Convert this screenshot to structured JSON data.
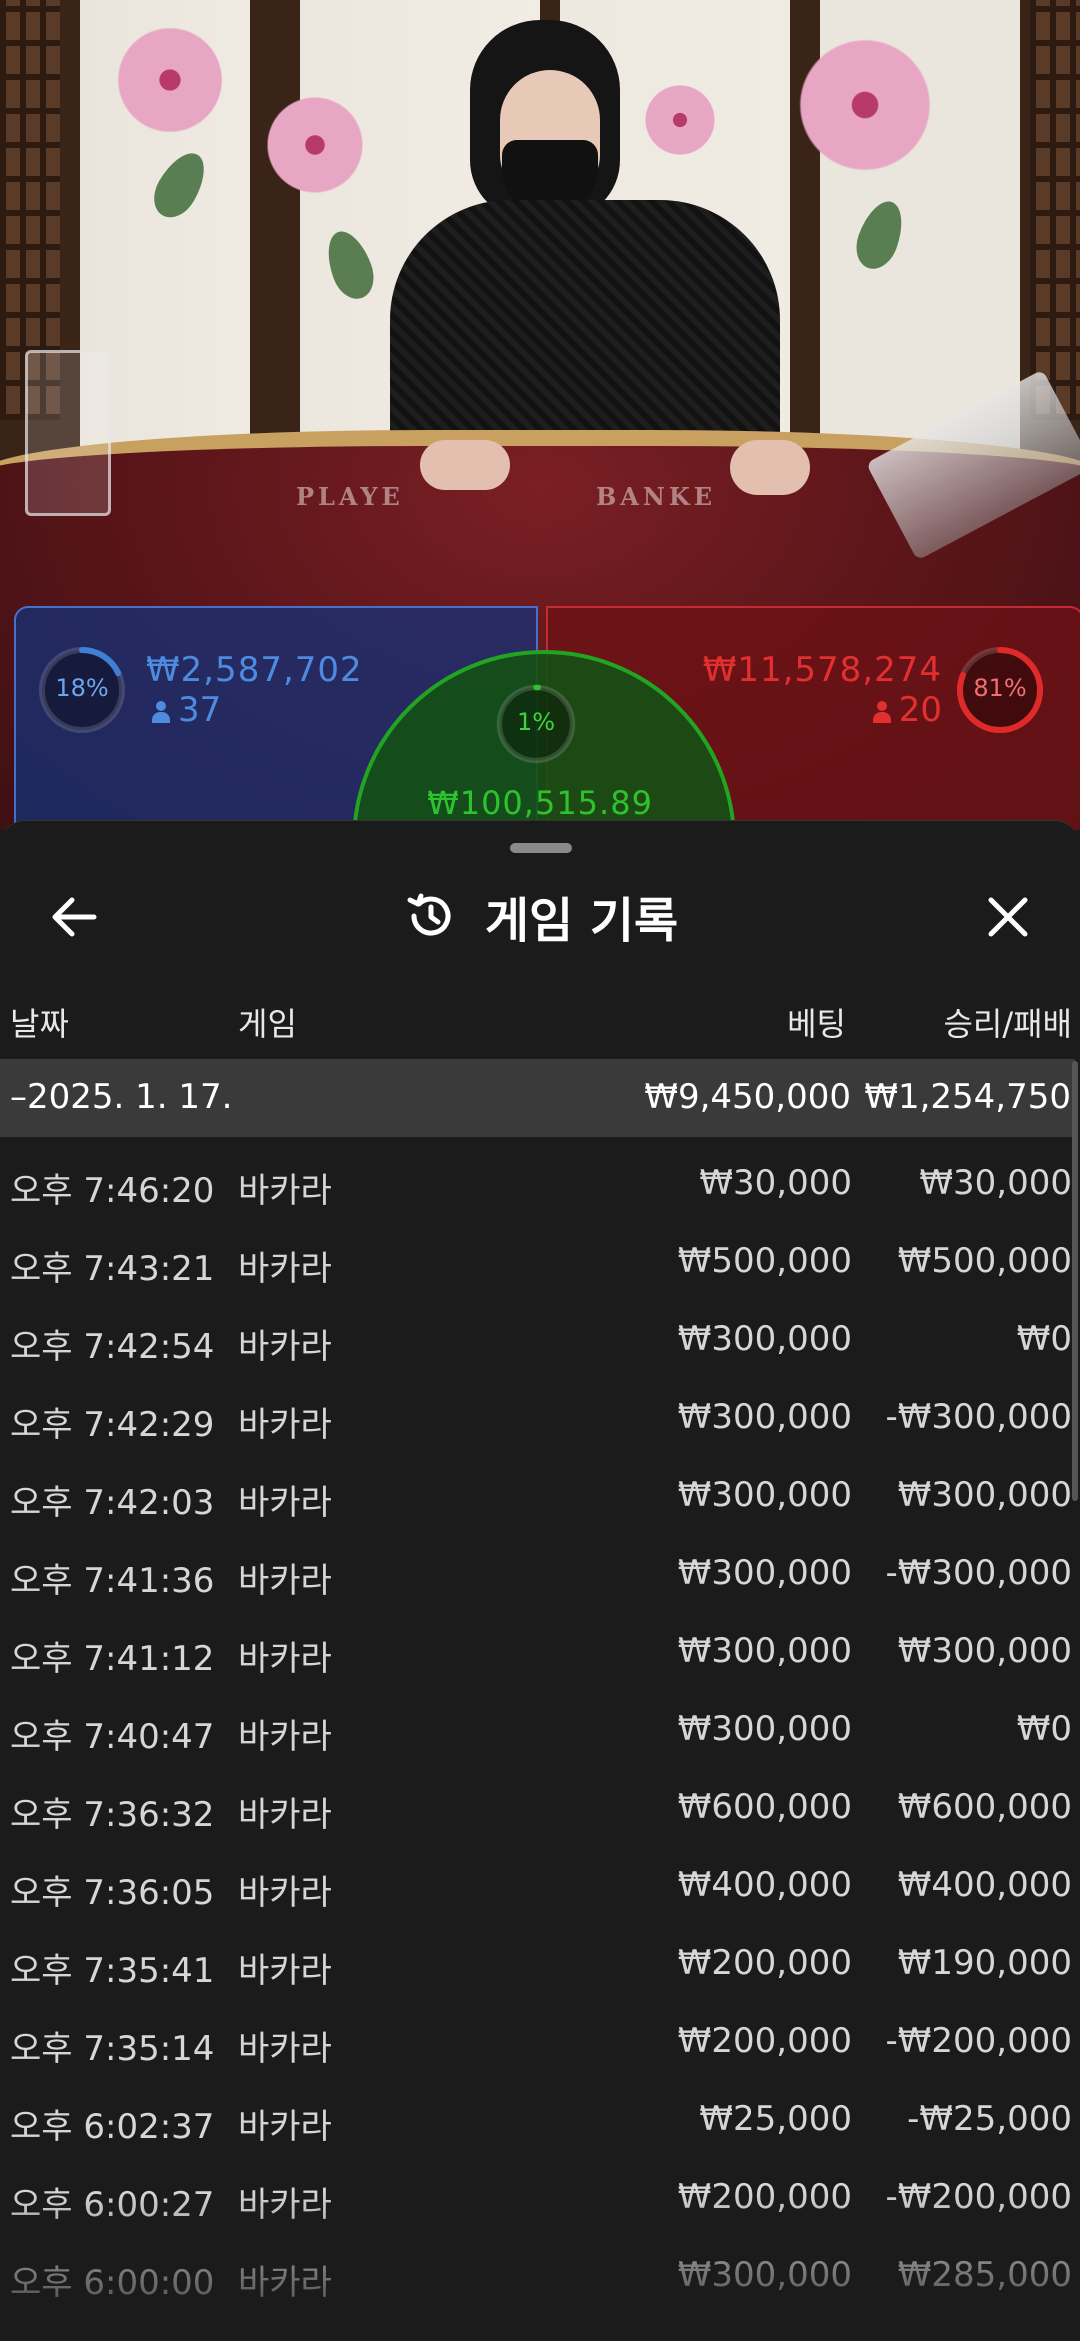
{
  "live_table": {
    "table_text_player": "PLAYE",
    "table_text_banker": "BANKE",
    "player": {
      "percent": "18%",
      "percent_value": 0.18,
      "amount": "₩2,587,702",
      "players": "37",
      "color": "#3f7fd6"
    },
    "banker": {
      "percent": "81%",
      "percent_value": 0.81,
      "amount": "₩11,578,274",
      "players": "20",
      "color": "#e02a2a"
    },
    "tie": {
      "percent": "1%",
      "percent_value": 0.01,
      "amount": "₩100,515.89",
      "color": "#2ec22e"
    }
  },
  "sheet": {
    "title": "게임 기록",
    "back_icon": "arrow-left-icon",
    "history_icon": "history-icon",
    "close_icon": "close-icon",
    "columns": {
      "date": "날짜",
      "game": "게임",
      "bet": "베팅",
      "result": "승리/패배"
    },
    "date_group": {
      "date": "–2025. 1. 17.",
      "bet_total": "₩9,450,000",
      "result_total": "₩1,254,750"
    },
    "rows": [
      {
        "time": "오후 7:46:20",
        "game": "바카라",
        "bet": "₩30,000",
        "result": "₩30,000"
      },
      {
        "time": "오후 7:43:21",
        "game": "바카라",
        "bet": "₩500,000",
        "result": "₩500,000"
      },
      {
        "time": "오후 7:42:54",
        "game": "바카라",
        "bet": "₩300,000",
        "result": "₩0"
      },
      {
        "time": "오후 7:42:29",
        "game": "바카라",
        "bet": "₩300,000",
        "result": "-₩300,000"
      },
      {
        "time": "오후 7:42:03",
        "game": "바카라",
        "bet": "₩300,000",
        "result": "₩300,000"
      },
      {
        "time": "오후 7:41:36",
        "game": "바카라",
        "bet": "₩300,000",
        "result": "-₩300,000"
      },
      {
        "time": "오후 7:41:12",
        "game": "바카라",
        "bet": "₩300,000",
        "result": "₩300,000"
      },
      {
        "time": "오후 7:40:47",
        "game": "바카라",
        "bet": "₩300,000",
        "result": "₩0"
      },
      {
        "time": "오후 7:36:32",
        "game": "바카라",
        "bet": "₩600,000",
        "result": "₩600,000"
      },
      {
        "time": "오후 7:36:05",
        "game": "바카라",
        "bet": "₩400,000",
        "result": "₩400,000"
      },
      {
        "time": "오후 7:35:41",
        "game": "바카라",
        "bet": "₩200,000",
        "result": "₩190,000"
      },
      {
        "time": "오후 7:35:14",
        "game": "바카라",
        "bet": "₩200,000",
        "result": "-₩200,000"
      },
      {
        "time": "오후 6:02:37",
        "game": "바카라",
        "bet": "₩25,000",
        "result": "-₩25,000"
      },
      {
        "time": "오후 6:00:27",
        "game": "바카라",
        "bet": "₩200,000",
        "result": "-₩200,000"
      },
      {
        "time": "오후 6:00:00",
        "game": "바카라",
        "bet": "₩300,000",
        "result": "₩285,000"
      }
    ]
  }
}
